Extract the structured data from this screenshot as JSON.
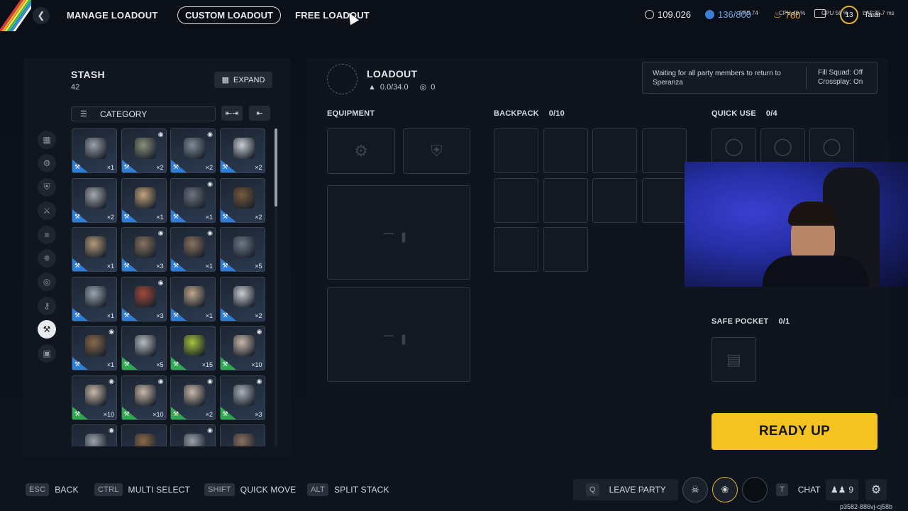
{
  "topbar": {
    "manage_loadout": "MANAGE LOADOUT",
    "custom_loadout": "CUSTOM LOADOUT",
    "free_loadout": "FREE LOADOUT",
    "credits": "109.026",
    "currency2": "136/800",
    "currency3": "760",
    "level": "13",
    "username": "Taiar",
    "fps_label": "FPS",
    "fps": "74",
    "cpu_label": "CPU",
    "cpu": "49 %",
    "gpu_label": "GPU",
    "gpu": "58 %",
    "lat_label": "LAT",
    "lat": "35.7 ms",
    "accent_stripes": [
      "#e23b3b",
      "#f0a830",
      "#f2e250",
      "#3cc864",
      "#3b8df0",
      "#ffffff"
    ]
  },
  "stash": {
    "title": "STASH",
    "count": "42",
    "expand_label": "EXPAND",
    "category_label": "CATEGORY",
    "side_icons": [
      "grid-icon",
      "attachment-icon",
      "shield-icon",
      "weapon-icon",
      "ammo-icon",
      "gear-icon",
      "ring-icon",
      "key-icon",
      "wrench-icon",
      "cube-icon"
    ],
    "active_side_icon": "wrench-icon",
    "items": [
      {
        "qty": "×1",
        "eye": false,
        "color": "#9aa1ab",
        "bar": "blue"
      },
      {
        "qty": "×2",
        "eye": true,
        "color": "#8b8f7a",
        "bar": "blue"
      },
      {
        "qty": "×2",
        "eye": true,
        "color": "#7f8a99",
        "bar": "blue"
      },
      {
        "qty": "×2",
        "eye": false,
        "color": "#c9ccd2",
        "bar": "blue"
      },
      {
        "qty": "×2",
        "eye": false,
        "color": "#a5a9ae",
        "bar": "blue"
      },
      {
        "qty": "×1",
        "eye": false,
        "color": "#c2a47a",
        "bar": "blue"
      },
      {
        "qty": "×1",
        "eye": true,
        "color": "#6e7580",
        "bar": "blue"
      },
      {
        "qty": "×2",
        "eye": false,
        "color": "#7a5a3a",
        "bar": "blue"
      },
      {
        "qty": "×1",
        "eye": false,
        "color": "#b49a78",
        "bar": "blue"
      },
      {
        "qty": "×3",
        "eye": true,
        "color": "#8a7260",
        "bar": "blue"
      },
      {
        "qty": "×1",
        "eye": true,
        "color": "#8a7260",
        "bar": "blue"
      },
      {
        "qty": "×5",
        "eye": false,
        "color": "#6d7888",
        "bar": "blue"
      },
      {
        "qty": "×1",
        "eye": false,
        "color": "#9aa4b0",
        "bar": "blue"
      },
      {
        "qty": "×3",
        "eye": true,
        "color": "#a24a3a",
        "bar": "blue"
      },
      {
        "qty": "×1",
        "eye": false,
        "color": "#bfa88c",
        "bar": "blue"
      },
      {
        "qty": "×2",
        "eye": false,
        "color": "#c9ccd2",
        "bar": "blue"
      },
      {
        "qty": "×1",
        "eye": true,
        "color": "#8a6a4a",
        "bar": "blue"
      },
      {
        "qty": "×5",
        "eye": false,
        "color": "#b8bcc2",
        "bar": "green"
      },
      {
        "qty": "×15",
        "eye": false,
        "color": "#a6c23a",
        "bar": "green"
      },
      {
        "qty": "×10",
        "eye": true,
        "color": "#c9b8a8",
        "bar": "green"
      },
      {
        "qty": "×10",
        "eye": true,
        "color": "#c9b8a8",
        "bar": "green"
      },
      {
        "qty": "×10",
        "eye": true,
        "color": "#c9b8a8",
        "bar": "green"
      },
      {
        "qty": "×2",
        "eye": true,
        "color": "#c9b8a8",
        "bar": "green"
      },
      {
        "qty": "×3",
        "eye": true,
        "color": "#a9b0b8",
        "bar": "green"
      },
      {
        "qty": "",
        "eye": true,
        "color": "#9aa1ab",
        "bar": "green"
      },
      {
        "qty": "",
        "eye": false,
        "color": "#8a6a4a",
        "bar": "green"
      },
      {
        "qty": "",
        "eye": true,
        "color": "#9aa1ab",
        "bar": "green"
      },
      {
        "qty": "",
        "eye": false,
        "color": "#8a7260",
        "bar": "green"
      }
    ]
  },
  "loadout": {
    "title": "LOADOUT",
    "weight": "0.0/34.0",
    "value": "0",
    "equipment_label": "EQUIPMENT",
    "backpack_label": "BACKPACK",
    "backpack_count": "0/10",
    "quick_use_label": "QUICK USE",
    "quick_use_count": "0/4",
    "safe_pocket_label": "SAFE POCKET",
    "safe_pocket_count": "0/1"
  },
  "status": {
    "waiting": "Waiting for all party members to return to Speranza",
    "fill_squad": "Fill Squad: Off",
    "crossplay": "Crossplay: On"
  },
  "ready_label": "READY UP",
  "bottom": {
    "hints": [
      {
        "key": "ESC",
        "label": "BACK"
      },
      {
        "key": "CTRL",
        "label": "MULTI SELECT"
      },
      {
        "key": "SHIFT",
        "label": "QUICK MOVE"
      },
      {
        "key": "ALT",
        "label": "SPLIT STACK"
      }
    ],
    "leave_key": "Q",
    "leave_label": "LEAVE PARTY",
    "chat_key": "T",
    "chat_label": "CHAT",
    "friends_count": "9",
    "footer_id": "p3582-886vj-cj58b"
  }
}
